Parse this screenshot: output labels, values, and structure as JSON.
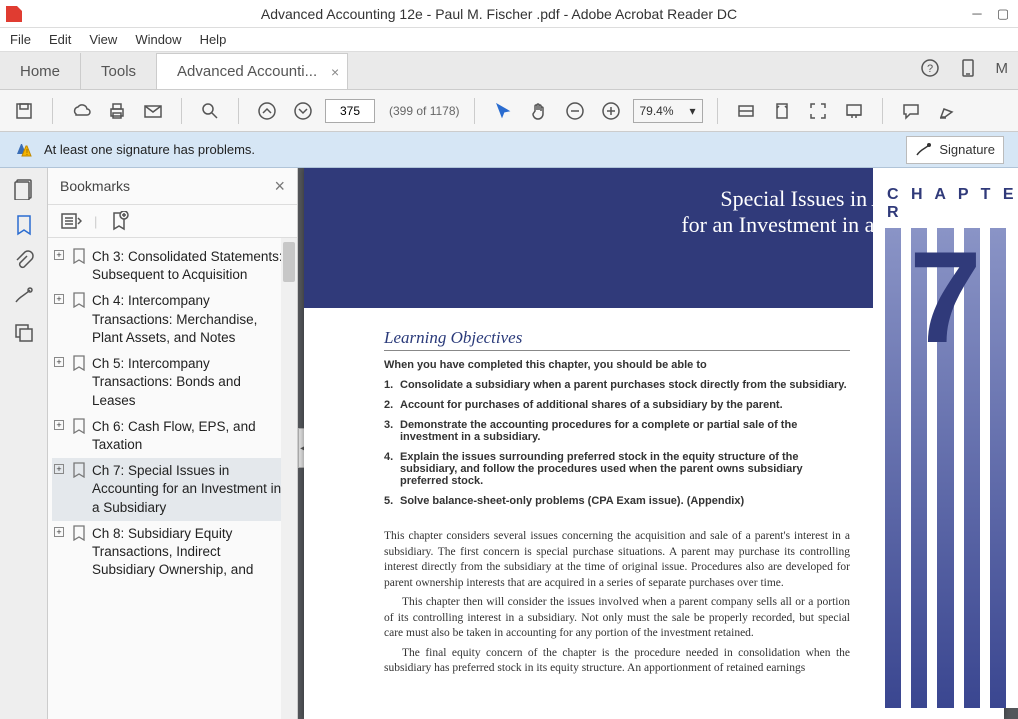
{
  "window": {
    "title": "Advanced Accounting 12e - Paul M. Fischer .pdf - Adobe Acrobat Reader DC"
  },
  "menu": {
    "items": [
      "File",
      "Edit",
      "View",
      "Window",
      "Help"
    ]
  },
  "tabs": {
    "home": "Home",
    "tools": "Tools",
    "doc": "Advanced Accounti...",
    "more": "M"
  },
  "toolbar": {
    "page_value": "375",
    "page_count": "(399 of 1178)",
    "zoom_value": "79.4%"
  },
  "signature_bar": {
    "message": "At least one signature has problems.",
    "panel_label": "Signature"
  },
  "bookmarks": {
    "title": "Bookmarks",
    "items": [
      {
        "label": "Ch 3: Consolidated Statements: Subsequent to Acquisition",
        "selected": false
      },
      {
        "label": "Ch 4: Intercompany Transactions: Merchandise, Plant Assets, and Notes",
        "selected": false
      },
      {
        "label": "Ch 5: Intercompany Transactions: Bonds and Leases",
        "selected": false
      },
      {
        "label": "Ch 6: Cash Flow, EPS, and Taxation",
        "selected": false
      },
      {
        "label": "Ch 7: Special Issues in Accounting for an Investment in a Subsidiary",
        "selected": true
      },
      {
        "label": "Ch 8: Subsidiary Equity Transactions, Indirect Subsidiary Ownership, and",
        "selected": false
      }
    ]
  },
  "document": {
    "chapter_word": "C H A P T E R",
    "chapter_number": "7",
    "title_line1": "Special Issues in Accounting",
    "title_line2": "for an Investment in a Subsidiary",
    "learning_objectives_heading": "Learning Objectives",
    "learning_objectives_intro": "When you have completed this chapter, you should be able to",
    "objectives": [
      "Consolidate a subsidiary when a parent purchases stock directly from the subsidiary.",
      "Account for purchases of additional shares of a subsidiary by the parent.",
      "Demonstrate the accounting procedures for a complete or partial sale of the investment in a subsidiary.",
      "Explain the issues surrounding preferred stock in the equity structure of the subsidiary, and follow the procedures used when the  parent owns subsidiary preferred stock.",
      "Solve balance-sheet-only problems (CPA Exam issue). (Appendix)"
    ],
    "body_paragraphs": [
      "This chapter considers several issues concerning the acquisition and sale of a parent's interest in a subsidiary. The first concern is special purchase situations. A parent may purchase its controlling interest directly from the subsidiary at the time of original issue. Procedures also are developed for parent ownership interests that are acquired in a series of separate purchases over time.",
      "This chapter then will consider the issues involved when a parent company sells all or a portion of its controlling interest in a subsidiary. Not only must the sale be properly recorded, but special care must also be taken in accounting for any portion of the investment retained.",
      "The final equity concern of the chapter is the procedure needed in consolidation when the subsidiary has preferred stock in its equity structure. An apportionment of retained earnings"
    ]
  }
}
